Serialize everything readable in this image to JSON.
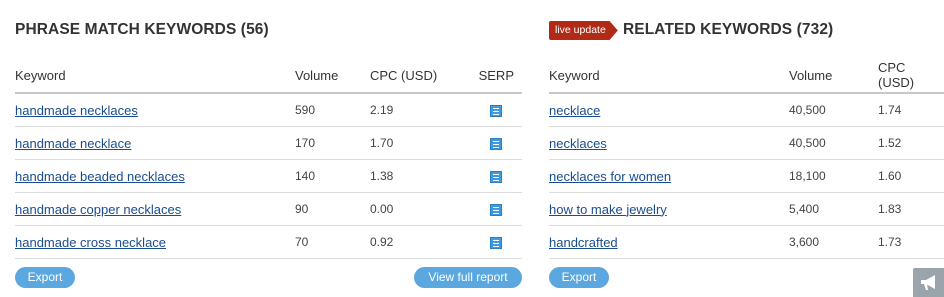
{
  "phrase_match": {
    "title": "PHRASE MATCH KEYWORDS (56)",
    "columns": [
      "Keyword",
      "Volume",
      "CPC (USD)",
      "SERP"
    ],
    "rows": [
      {
        "keyword": "handmade necklaces",
        "volume": "590",
        "cpc": "2.19"
      },
      {
        "keyword": "handmade necklace",
        "volume": "170",
        "cpc": "1.70"
      },
      {
        "keyword": "handmade beaded necklaces",
        "volume": "140",
        "cpc": "1.38"
      },
      {
        "keyword": "handmade copper necklaces",
        "volume": "90",
        "cpc": "0.00"
      },
      {
        "keyword": "handmade cross necklace",
        "volume": "70",
        "cpc": "0.92"
      }
    ],
    "export_label": "Export",
    "view_full_label": "View full report"
  },
  "related": {
    "badge": "live update",
    "title": "RELATED KEYWORDS (732)",
    "columns": [
      "Keyword",
      "Volume",
      "CPC (USD)"
    ],
    "rows": [
      {
        "keyword": "necklace",
        "volume": "40,500",
        "cpc": "1.74"
      },
      {
        "keyword": "necklaces",
        "volume": "40,500",
        "cpc": "1.52"
      },
      {
        "keyword": "necklaces for women",
        "volume": "18,100",
        "cpc": "1.60"
      },
      {
        "keyword": "how to make jewelry",
        "volume": "5,400",
        "cpc": "1.83"
      },
      {
        "keyword": "handcrafted",
        "volume": "3,600",
        "cpc": "1.73"
      }
    ],
    "export_label": "Export"
  },
  "icons": {
    "serp": "serp-icon",
    "feedback": "megaphone-icon"
  },
  "colors": {
    "link": "#1a4d8f",
    "button": "#5ba7e0",
    "badge": "#b02a16",
    "fab": "#9aa4ab"
  }
}
